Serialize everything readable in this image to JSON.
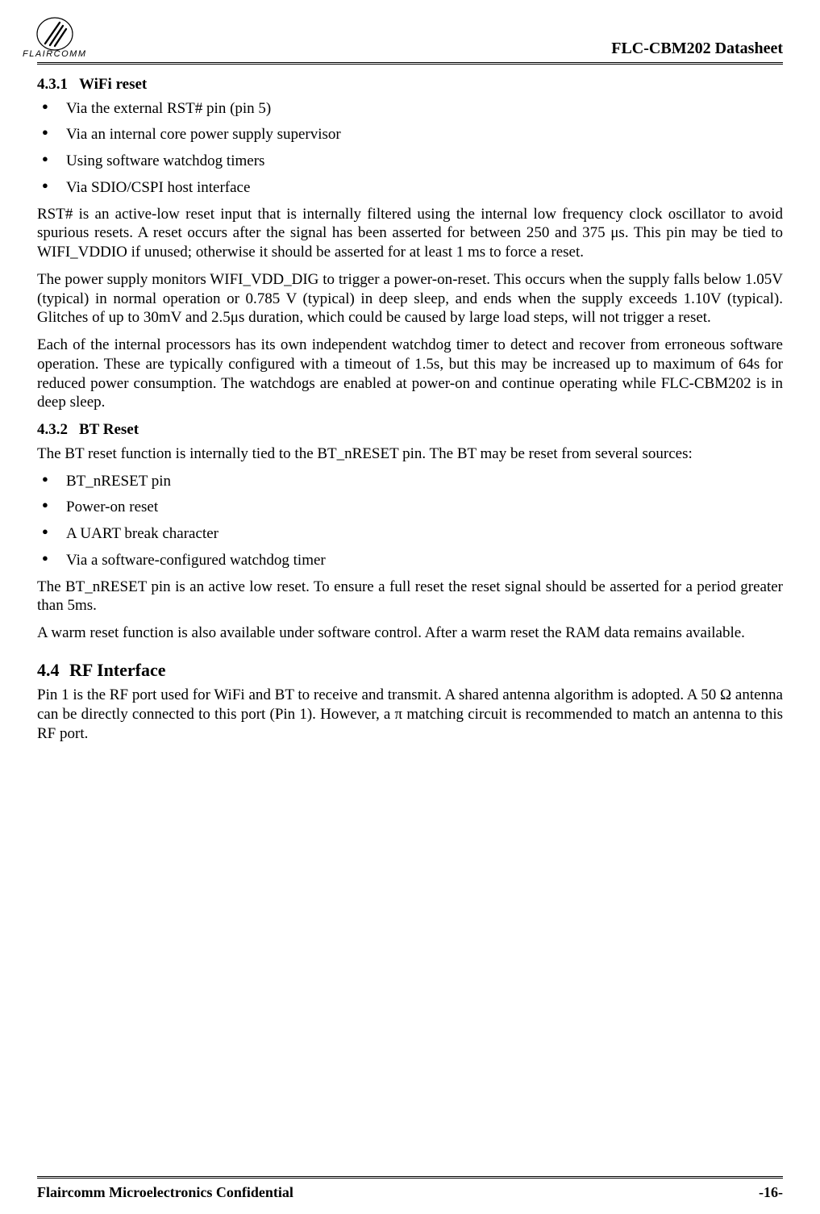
{
  "header": {
    "brand": "FLAIRCOMM",
    "doc_title": "FLC-CBM202 Datasheet"
  },
  "section_431": {
    "number": "4.3.1",
    "title": "WiFi reset",
    "bullets": [
      "Via the external RST# pin (pin 5)",
      "Via an internal core power supply supervisor",
      "Using software watchdog timers",
      "Via SDIO/CSPI host interface"
    ],
    "para1": "RST# is an active-low reset input that is internally filtered using the internal low frequency clock oscillator to avoid spurious resets.  A reset occurs after the signal has been asserted for between 250 and 375 μs.  This pin may be tied to WIFI_VDDIO if unused; otherwise it should be asserted for at least 1 ms to force a reset.",
    "para2": "The power supply monitors WIFI_VDD_DIG to trigger a power-on-reset.  This occurs when the supply falls below 1.05V (typical) in normal operation or 0.785 V (typical) in deep sleep, and ends when the supply exceeds 1.10V (typical).  Glitches of up to 30mV and 2.5μs duration, which could be caused by large load steps, will not trigger a reset.",
    "para3": "Each of the internal processors has its own independent watchdog timer to detect and recover from erroneous software operation.  These are typically configured with a timeout of 1.5s, but this may be increased up to maximum of 64s for reduced power consumption.  The watchdogs are enabled at power-on and continue operating while FLC-CBM202 is in deep sleep."
  },
  "section_432": {
    "number": "4.3.2",
    "title": "BT Reset",
    "para1": "The BT reset function is internally tied to the BT_nRESET pin. The BT may be reset from several sources:",
    "bullets": [
      "BT_nRESET pin",
      "Power-on reset",
      "A UART break character",
      "Via a software-configured watchdog timer"
    ],
    "para2": "The BT_nRESET pin is an active low reset. To ensure a full reset the reset signal should be asserted for a period greater than 5ms.",
    "para3": "A warm reset function is also available under software control. After a warm reset the RAM data remains available."
  },
  "section_44": {
    "number": "4.4",
    "title": "RF Interface",
    "para1": "Pin 1 is the RF port used for WiFi and BT to receive and transmit.  A shared antenna algorithm is adopted. A 50 Ω antenna can be directly connected to this port (Pin 1).  However, a π matching circuit is recommended to match an antenna to this RF port."
  },
  "footer": {
    "left": "Flaircomm Microelectronics Confidential",
    "right": "-16-"
  }
}
